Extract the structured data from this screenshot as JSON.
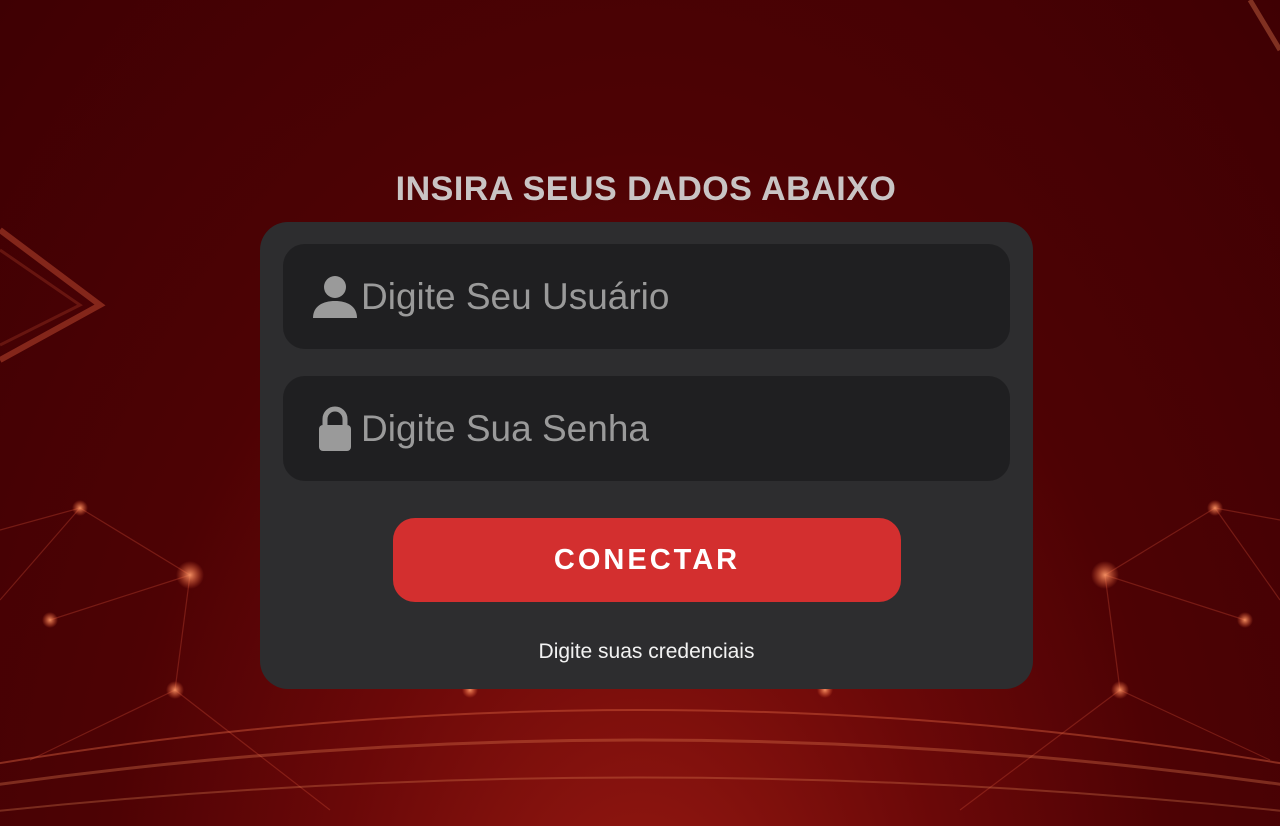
{
  "login": {
    "heading": "INSIRA SEUS DADOS ABAIXO",
    "username_placeholder": "Digite Seu Usuário",
    "username_icon": "user-icon",
    "password_placeholder": "Digite Sua Senha",
    "password_icon": "lock-icon",
    "connect_label": "CONECTAR",
    "hint": "Digite suas credenciais"
  },
  "colors": {
    "background": "#4d0204",
    "card": "#2d2d2f",
    "field": "#1f1f21",
    "button": "#d32f2f",
    "placeholder": "#9a9a9a",
    "heading": "#c9c4c4"
  }
}
